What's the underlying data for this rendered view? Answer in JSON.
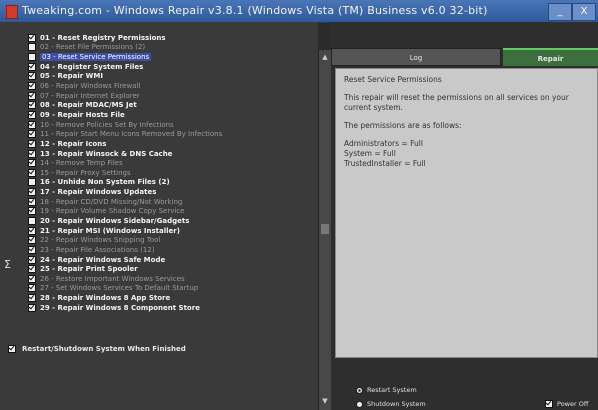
{
  "window": {
    "title": "Tweaking.com - Windows Repair v3.8.1 (Windows Vista (TM) Business v6.0 32-bit)",
    "minimize_label": "_",
    "close_label": "X"
  },
  "side_marker": "Σ",
  "repairs": [
    {
      "label": "01 - Reset Registry Permissions",
      "checked": true,
      "style": "major"
    },
    {
      "label": "02 - Reset File Permissions (2)",
      "checked": false,
      "style": "minor"
    },
    {
      "label": "03 - Reset Service Permissions",
      "checked": false,
      "style": "selected"
    },
    {
      "label": "04 - Register System Files",
      "checked": true,
      "style": "major"
    },
    {
      "label": "05 - Repair WMI",
      "checked": true,
      "style": "major"
    },
    {
      "label": "06 - Repair Windows Firewall",
      "checked": true,
      "style": "minor"
    },
    {
      "label": "07 - Repair Internet Explorer",
      "checked": true,
      "style": "minor"
    },
    {
      "label": "08 - Repair MDAC/MS Jet",
      "checked": true,
      "style": "major"
    },
    {
      "label": "09 - Repair Hosts File",
      "checked": true,
      "style": "major"
    },
    {
      "label": "10 - Remove Policies Set By Infections",
      "checked": true,
      "style": "minor"
    },
    {
      "label": "11 - Repair Start Menu Icons Removed By Infections",
      "checked": true,
      "style": "minor"
    },
    {
      "label": "12 - Repair Icons",
      "checked": true,
      "style": "major"
    },
    {
      "label": "13 - Repair Winsock & DNS Cache",
      "checked": true,
      "style": "major"
    },
    {
      "label": "14 - Remove Temp Files",
      "checked": true,
      "style": "minor"
    },
    {
      "label": "15 - Repair Proxy Settings",
      "checked": true,
      "style": "minor"
    },
    {
      "label": "16 - Unhide Non System Files (2)",
      "checked": false,
      "style": "major"
    },
    {
      "label": "17 - Repair Windows Updates",
      "checked": true,
      "style": "major"
    },
    {
      "label": "18 - Repair CD/DVD Missing/Not Working",
      "checked": true,
      "style": "minor"
    },
    {
      "label": "19 - Repair Volume Shadow Copy Service",
      "checked": true,
      "style": "minor"
    },
    {
      "label": "20 - Repair Windows Sidebar/Gadgets",
      "checked": false,
      "style": "major"
    },
    {
      "label": "21 - Repair MSI (Windows Installer)",
      "checked": true,
      "style": "major"
    },
    {
      "label": "22 - Repair Windows Snipping Tool",
      "checked": true,
      "style": "minor"
    },
    {
      "label": "23 - Repair File Associations (12)",
      "checked": true,
      "style": "minor"
    },
    {
      "label": "24 - Repair Windows Safe Mode",
      "checked": true,
      "style": "major"
    },
    {
      "label": "25 - Repair Print Spooler",
      "checked": true,
      "style": "major"
    },
    {
      "label": "26 - Restore Important Windows Services",
      "checked": true,
      "style": "minor"
    },
    {
      "label": "27 - Set Windows Services To Default Startup",
      "checked": true,
      "style": "minor"
    },
    {
      "label": "28 - Repair Windows 8 App Store",
      "checked": true,
      "style": "major"
    },
    {
      "label": "29 - Repair Windows 8 Component Store",
      "checked": true,
      "style": "major"
    }
  ],
  "tabs": {
    "log": "Log",
    "repair": "Repair"
  },
  "detail": {
    "heading": "Reset Service Permissions",
    "description": "This repair will reset the permissions on all services on your current system.",
    "intro": "The permissions are as follows:",
    "perms": [
      "Administrators = Full",
      "System = Full",
      "TrustedInstaller = Full"
    ]
  },
  "options": {
    "restart_label": "Restart/Shutdown System When Finished",
    "restart_checked": true,
    "restart_radio": "Restart System",
    "shutdown_radio": "Shutdown System",
    "selected_radio": "restart",
    "power_off_label": "Power Off"
  }
}
